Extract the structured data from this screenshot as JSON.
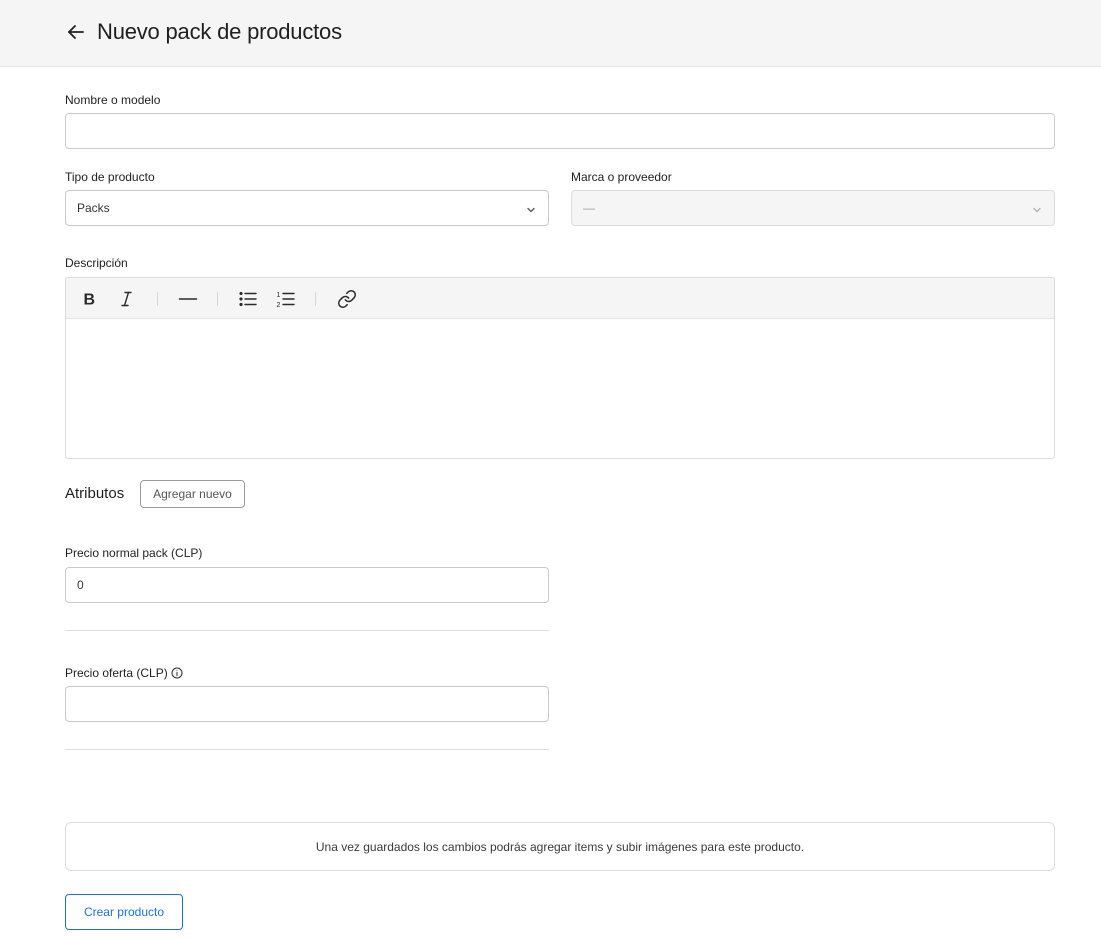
{
  "header": {
    "title": "Nuevo pack de productos",
    "back_icon": "arrow-left-icon"
  },
  "form": {
    "name": {
      "label": "Nombre o modelo",
      "value": ""
    },
    "product_type": {
      "label": "Tipo de producto",
      "selected": "Packs"
    },
    "brand": {
      "label": "Marca o proveedor",
      "selected": "—",
      "disabled": true
    },
    "description": {
      "label": "Descripción",
      "toolbar": [
        "bold-icon",
        "italic-icon",
        "horizontal-rule-icon",
        "bullet-list-icon",
        "ordered-list-icon",
        "link-icon"
      ],
      "value": ""
    },
    "attributes": {
      "title": "Atributos",
      "add_label": "Agregar nuevo"
    },
    "normal_price": {
      "label": "Precio normal pack (CLP)",
      "value": "0"
    },
    "offer_price": {
      "label": "Precio oferta (CLP)",
      "value": "",
      "info_icon": "info-icon"
    }
  },
  "notice": {
    "text": "Una vez guardados los cambios podrás agregar items y subir imágenes para este producto."
  },
  "actions": {
    "create_label": "Crear producto"
  },
  "colors": {
    "accent": "#1e6fd9",
    "header_bg": "#f5f5f6",
    "border": "#c9c9ce"
  }
}
